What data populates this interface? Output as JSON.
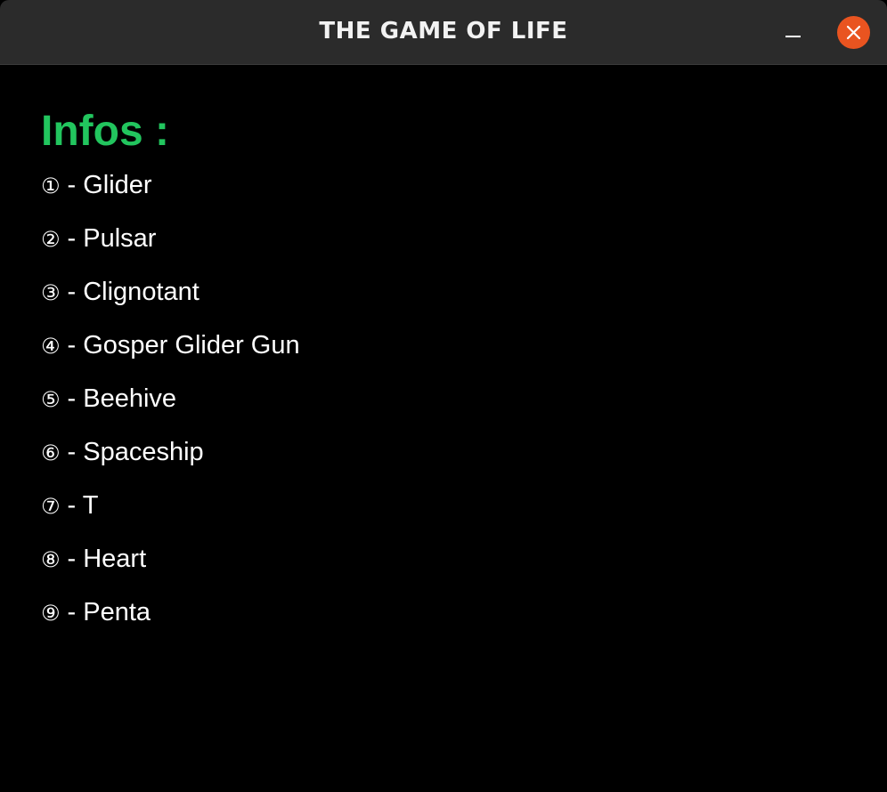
{
  "window": {
    "title": "THE GAME OF LIFE"
  },
  "controls": {
    "minimize_icon": "minimize-icon",
    "close_icon": "close-icon",
    "close_color": "#e95420"
  },
  "content": {
    "heading": "Infos :",
    "heading_color": "#22c55e",
    "items": [
      {
        "number": "①",
        "label": "- Glider"
      },
      {
        "number": "②",
        "label": "- Pulsar"
      },
      {
        "number": "③",
        "label": "- Clignotant"
      },
      {
        "number": "④",
        "label": "- Gosper Glider Gun"
      },
      {
        "number": "⑤",
        "label": "- Beehive"
      },
      {
        "number": "⑥",
        "label": "- Spaceship"
      },
      {
        "number": "⑦",
        "label": "- T"
      },
      {
        "number": "⑧",
        "label": "- Heart"
      },
      {
        "number": "⑨",
        "label": "- Penta"
      }
    ]
  }
}
